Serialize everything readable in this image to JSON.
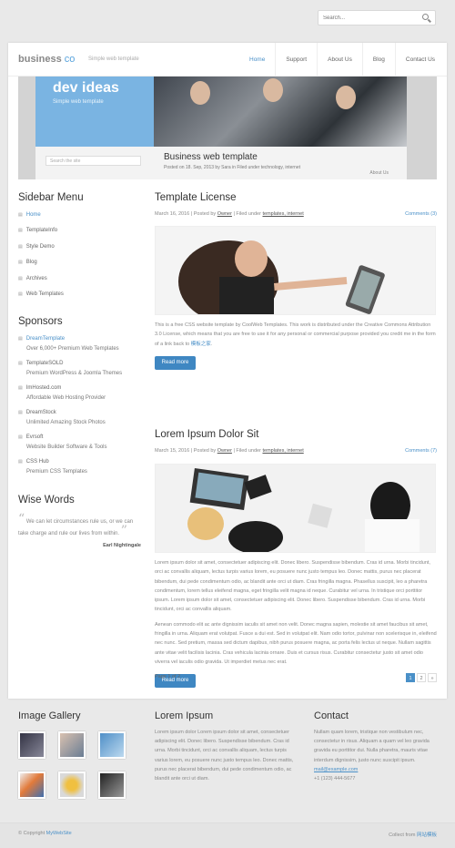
{
  "search": {
    "placeholder": "Search..."
  },
  "header": {
    "logo_main": "business",
    "logo_accent": "co",
    "tagline": "Simple web template"
  },
  "nav": [
    "Home",
    "Support",
    "About Us",
    "Blog",
    "Contact Us"
  ],
  "banner": {
    "title": "dev ideas",
    "subtitle": "Simple web template",
    "search_placeholder": "Search the site",
    "post_title": "Business web template",
    "post_meta": "Posted on 18. Sep, 2013 by Sara in Filed under technology, internet",
    "about": "About Us"
  },
  "sidebar": {
    "menu_title": "Sidebar Menu",
    "menu": [
      "Home",
      "TemplateInfo",
      "Style Demo",
      "Blog",
      "Archives",
      "Web Templates"
    ],
    "sponsors_title": "Sponsors",
    "sponsors": [
      {
        "name": "DreamTemplate",
        "desc": "Over 6,000+ Premium Web Templates"
      },
      {
        "name": "TemplateSOLD",
        "desc": "Premium WordPress & Joomla Themes"
      },
      {
        "name": "ImHosted.com",
        "desc": "Affordable Web Hosting Provider"
      },
      {
        "name": "DreamStock",
        "desc": "Unlimited Amazing Stock Photos"
      },
      {
        "name": "Evrsoft",
        "desc": "Website Builder Software & Tools"
      },
      {
        "name": "CSS Hub",
        "desc": "Premium CSS Templates"
      }
    ],
    "wise_title": "Wise Words",
    "quote": "We can let circumstances rule us, or we can take charge and rule our lives from within.",
    "author": "Earl Nightingale"
  },
  "posts": [
    {
      "title": "Template License",
      "date": "March 16, 2016",
      "posted_by": "Posted by",
      "author": "Owner",
      "filed": "Filed under",
      "tags": "templates, internet",
      "comments": "Comments (3)",
      "text": "This is a free CSS website template by CoolWeb Templates. This work is distributed under the Creative Commons Attribution 3.0 License, which means that you are free to use it for any personal or commercial purpose provided you credit me in the form of a link back to",
      "link": "模板之家",
      "button": "Read more"
    },
    {
      "title": "Lorem Ipsum Dolor Sit",
      "date": "March 15, 2016",
      "posted_by": "Posted by",
      "author": "Owner",
      "filed": "Filed under",
      "tags": "templates, internet",
      "comments": "Comments (7)",
      "text1": "Lorem ipsum dolor sit amet, consectetuer adipiscing elit. Donec libero. Suspendisse bibendum. Cras id urna. Morbi tincidunt, orci ac convallis aliquam, lectus turpis varius lorem, eu posuere nunc justo tempus leo. Donec mattis, purus nec placerat bibendum, dui pede condimentum odio, ac blandit ante orci ut diam. Cras fringilla magna. Phasellus suscipit, leo a pharetra condimentum, lorem tellus eleifend magna, eget fringilla velit magna id neque. Curabitur vel urna. In tristique orci porttitor ipsum. Lorem ipsum dolor sit amet, consectetuer adipiscing elit. Donec libero. Suspendisse bibendum. Cras id urna. Morbi tincidunt, orci ac convallis aliquam.",
      "text2": "Aenean commodo elit ac ante dignissim iaculis sit amet non velit. Donec magna sapien, molestie sit amet faucibus sit amet, fringilla in urna. Aliquam erat volutpat. Fusce a dui est. Sed in volutpat elit. Nam odio tortor, pulvinar non scelerisque in, eleifend nec nunc. Sed pretium, massa sed dictum dapibus, nibh purus posuere magna, ac porta felis lectus ut neque. Nullam sagittis ante vitae velit facilisis lacinia. Cras vehicula lacinia ornare. Duis et cursus risus. Curabitur consectetur justo sit amet odio viverra vel iaculis odio gravida. Ut imperdiet metus nec erat.",
      "button": "Read more"
    }
  ],
  "pager": {
    "label": "Page 1 of 2",
    "pages": [
      "1",
      "2",
      "»"
    ]
  },
  "footer": {
    "gallery_title": "Image Gallery",
    "lorem_title": "Lorem Ipsum",
    "lorem_text": "Lorem ipsum dolor Lorem ipsum dolor sit amet, consectetuer adipiscing elit. Donec libero. Suspendisse bibendum. Cras id urna. Morbi tincidunt, orci ac convallis aliquam, lectus turpis varius lorem, eu posuere nunc justo tempus leo. Donec mattis, purus nec placerat bibendum, dui pede condimentum odio, ac blandit ante orci ut diam.",
    "contact_title": "Contact",
    "contact_text": "Nullam quam lorem, tristique non vestibulum nec, consectetur in risus. Aliquam a quam vel leo gravida gravida eu porttitor dui. Nulla pharetra, mauris vitae interdum dignissim, justo nunc suscipit ipsum.",
    "email": "mail@example.com",
    "phone": "+1 (123) 444-5677"
  },
  "copyright": {
    "prefix": "© Copyright",
    "site": "MyWebSite",
    "collect": "Collect from",
    "collect_link": "网站模板"
  }
}
